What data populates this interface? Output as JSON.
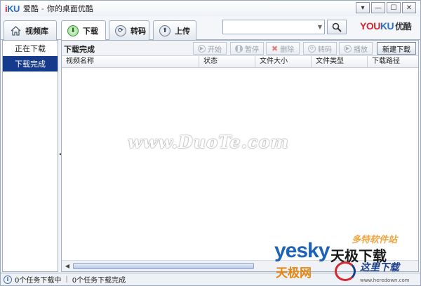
{
  "title": {
    "logo": "iKU",
    "app_name": "爱酷",
    "separator": "-",
    "subtitle": "你的桌面优酷"
  },
  "window_controls": {
    "dropdown": "▾",
    "minimize": "—",
    "maximize": "☐",
    "close": "✕"
  },
  "tabs": [
    {
      "label": "视频库",
      "icon": "home-icon"
    },
    {
      "label": "下载",
      "icon": "download-icon",
      "active": true
    },
    {
      "label": "转码",
      "icon": "convert-icon"
    },
    {
      "label": "上传",
      "icon": "upload-icon"
    }
  ],
  "search": {
    "value": "",
    "placeholder": ""
  },
  "brand": {
    "youku": "YOU",
    "ku": "KU",
    "cn": "优酷"
  },
  "sidebar": {
    "items": [
      {
        "label": "正在下载",
        "selected": false
      },
      {
        "label": "下载完成",
        "selected": true
      }
    ]
  },
  "main": {
    "section_title": "下载完成",
    "buttons": {
      "start": "开始",
      "pause": "暂停",
      "delete": "删除",
      "convert": "转码",
      "play": "播放",
      "new_download": "新建下载"
    },
    "columns": [
      "视频名称",
      "状态",
      "文件大小",
      "文件类型",
      "下载路径"
    ],
    "rows": []
  },
  "watermark": "www.DuoTe.com",
  "status": {
    "downloading": "0个任务下载中",
    "separator": "|",
    "completed": "0个任务下载完成"
  },
  "overlay_logos": {
    "yesky": "yesky",
    "yesky_cn": "天极下载",
    "yesky_cn2": "天极网",
    "duote": "多特软件站",
    "here": "这里下载",
    "here_url": "www.heredown.com"
  },
  "colors": {
    "selected_nav": "#163a8c",
    "brand_red": "#d8262e",
    "brand_blue": "#2b6fc2"
  }
}
